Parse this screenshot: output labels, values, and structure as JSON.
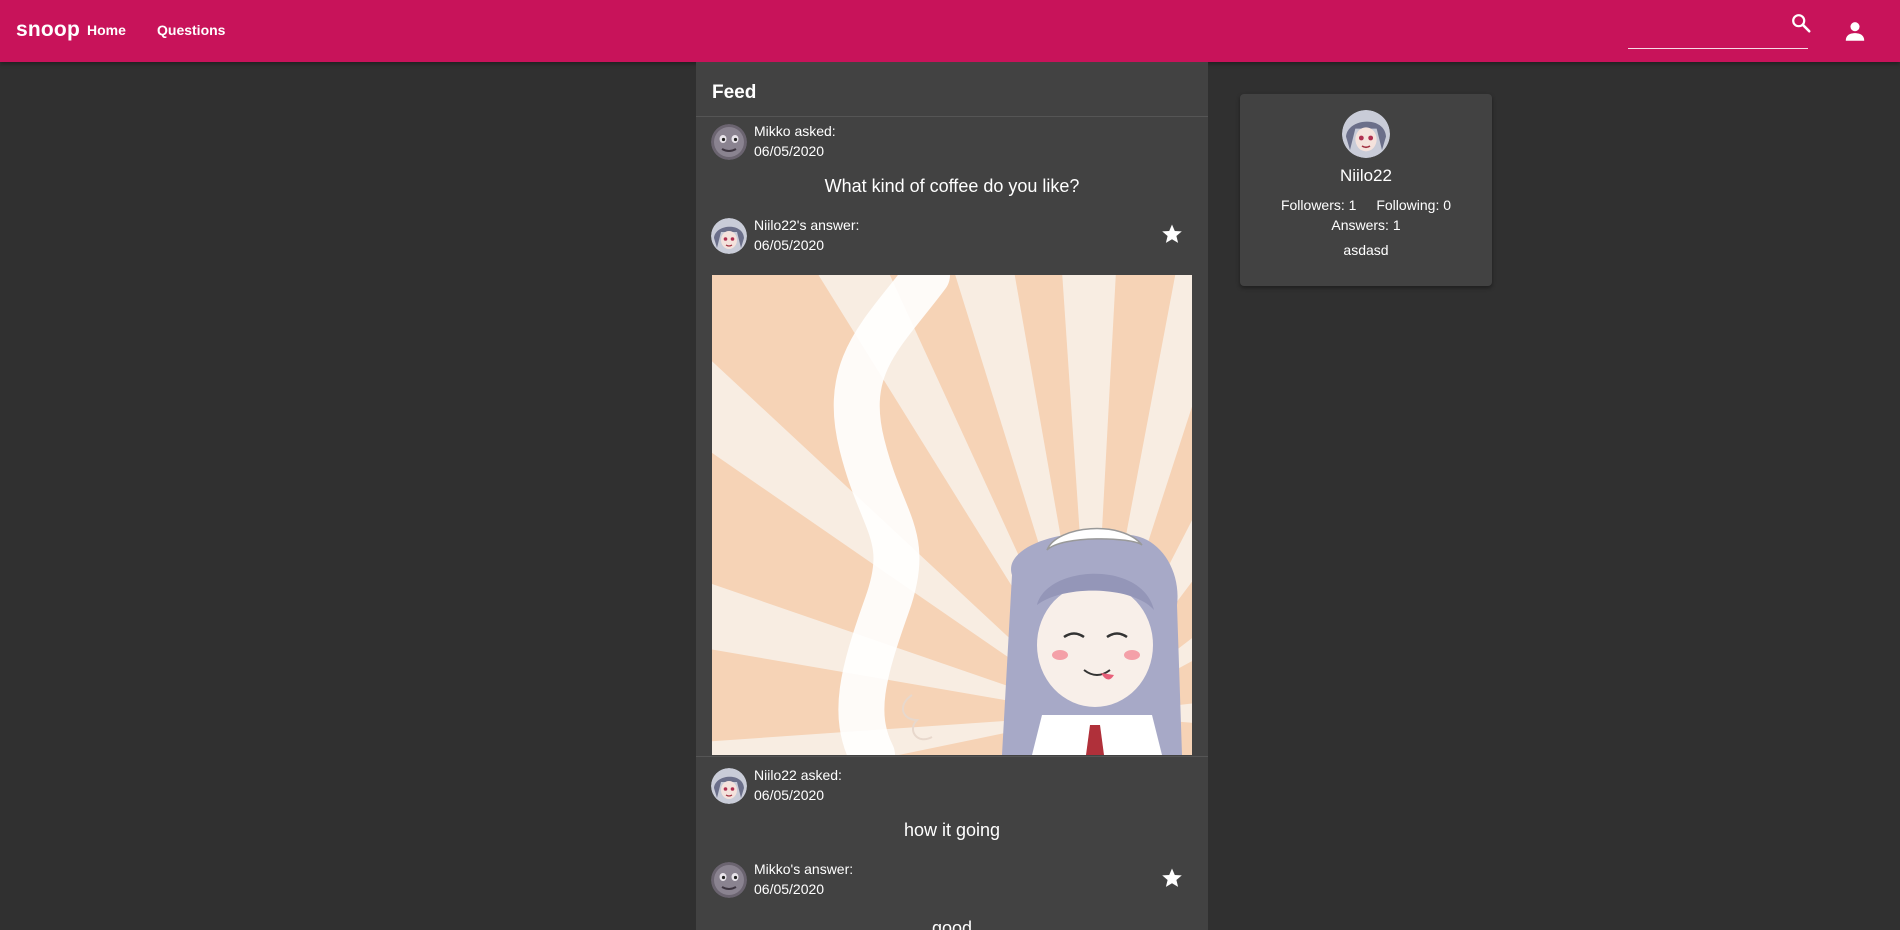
{
  "appbar": {
    "brand": "snoop",
    "nav": {
      "home": "Home",
      "questions": "Questions"
    },
    "search": {
      "value": "",
      "placeholder": ""
    },
    "color": "#c8135a"
  },
  "feed": {
    "title": "Feed",
    "posts": [
      {
        "asker_line": "Mikko asked:",
        "asked_date": "06/05/2020",
        "question": "What kind of coffee do you like?",
        "answer_line": "Niilo22's answer:",
        "answer_date": "06/05/2020",
        "answer_image": "coffee-maid-illustration"
      },
      {
        "asker_line": "Niilo22 asked:",
        "asked_date": "06/05/2020",
        "question": "how it going",
        "answer_line": "Mikko's answer:",
        "answer_date": "06/05/2020",
        "answer_text": "good"
      }
    ]
  },
  "profile": {
    "name": "Niilo22",
    "followers": "Followers: 1",
    "following": "Following: 0",
    "answers": "Answers: 1",
    "bio": "asdasd"
  },
  "icons": {
    "search": "search-icon",
    "user": "account-icon",
    "star": "star-icon"
  }
}
